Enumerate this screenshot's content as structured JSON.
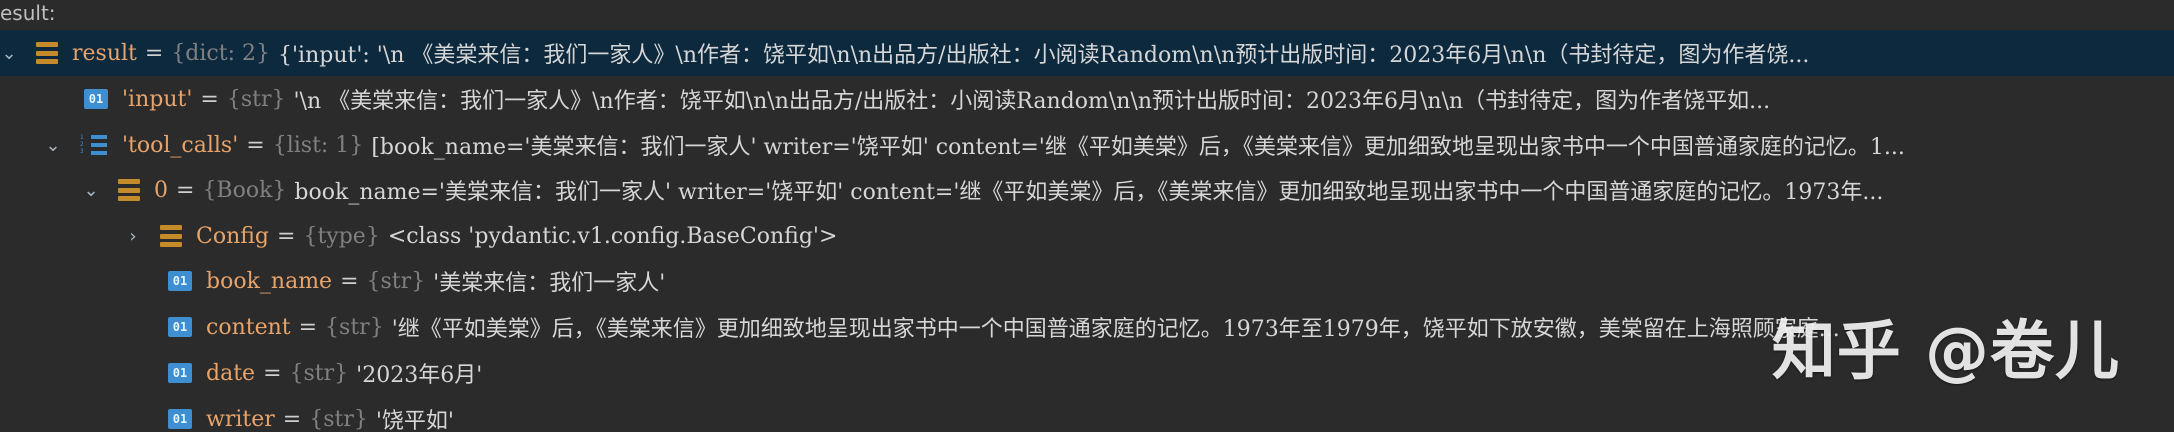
{
  "header": {
    "title": "esult:"
  },
  "rows": [
    {
      "name": "result",
      "eq": " = ",
      "type": "{dict: 2}",
      "value": "{'input': '\\n            《美棠来信：我们一家人》\\n作者：饶平如\\n\\n出品方/出版社：小阅读Random\\n\\n预计出版时间：2023年6月\\n\\n（书封待定，图为作者饶..."
    },
    {
      "name": "'input'",
      "eq": " = ",
      "type": "{str}",
      "value": "'\\n            《美棠来信：我们一家人》\\n作者：饶平如\\n\\n出品方/出版社：小阅读Random\\n\\n预计出版时间：2023年6月\\n\\n（书封待定，图为作者饶平如..."
    },
    {
      "name": "'tool_calls'",
      "eq": " = ",
      "type": "{list: 1}",
      "value": "[book_name='美棠来信：我们一家人' writer='饶平如' content='继《平如美棠》后，《美棠来信》更加细致地呈现出家书中一个中国普通家庭的记忆。1..."
    },
    {
      "name": "0",
      "eq": " = ",
      "type": "{Book}",
      "value": "book_name='美棠来信：我们一家人' writer='饶平如' content='继《平如美棠》后，《美棠来信》更加细致地呈现出家书中一个中国普通家庭的记忆。1973年..."
    },
    {
      "name": "Config",
      "eq": " = ",
      "type": "{type}",
      "value": "<class 'pydantic.v1.config.BaseConfig'>"
    },
    {
      "name": "book_name",
      "eq": " = ",
      "type": "{str}",
      "value": "'美棠来信：我们一家人'"
    },
    {
      "name": "content",
      "eq": " = ",
      "type": "{str}",
      "value": "'继《平如美棠》后，《美棠来信》更加细致地呈现出家书中一个中国普通家庭的记忆。1973年至1979年，饶平如下放安徽，美棠留在上海照顾家庭..."
    },
    {
      "name": "date",
      "eq": " = ",
      "type": "{str}",
      "value": "'2023年6月'"
    },
    {
      "name": "writer",
      "eq": " = ",
      "type": "{str}",
      "value": "'饶平如'"
    }
  ],
  "icons": {
    "result": "dict-icon",
    "input": "str-icon",
    "tool_calls": "list-icon",
    "zero": "object-icon",
    "config": "type-icon",
    "book_name": "str-icon",
    "content": "str-icon",
    "date": "str-icon",
    "writer": "str-icon"
  },
  "watermark": "知乎 @卷儿",
  "colors": {
    "background": "#2b2b2b",
    "selected_row": "#0d293e",
    "name": "#e8a36a",
    "type": "#808080",
    "icon_blue": "#3d8fd2",
    "icon_orange": "#c58a2a"
  }
}
